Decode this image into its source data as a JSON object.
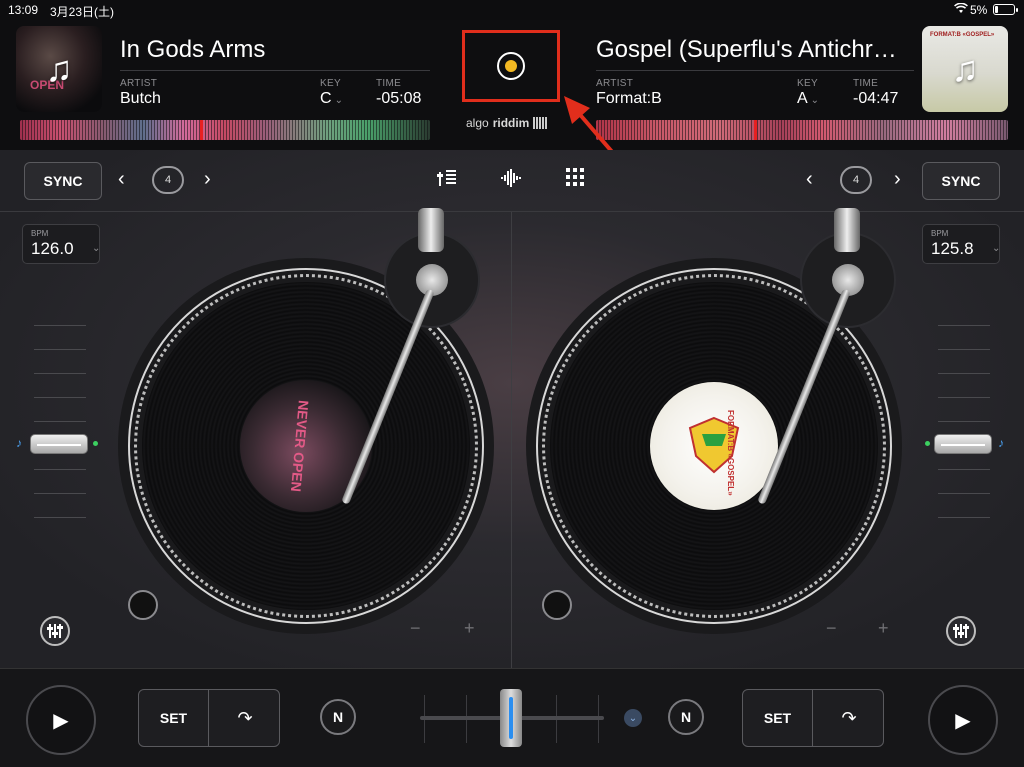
{
  "status_bar": {
    "time": "13:09",
    "date": "3月23日(土)",
    "battery": "5%"
  },
  "left_deck": {
    "title": "In Gods Arms",
    "artist_label": "ARTIST",
    "artist": "Butch",
    "key_label": "KEY",
    "key": "C",
    "time_label": "TIME",
    "time": "-05:08",
    "bpm_label": "BPM",
    "bpm": "126.0",
    "loop_count": "4",
    "sync": "SYNC",
    "set": "SET",
    "cover_text": "OPEN",
    "label_text": "NEVER OPEN"
  },
  "right_deck": {
    "title": "Gospel (Superflu's Antichr…",
    "artist_label": "ARTIST",
    "artist": "Format:B",
    "key_label": "KEY",
    "key": "A",
    "time_label": "TIME",
    "time": "-04:47",
    "bpm_label": "BPM",
    "bpm": "125.8",
    "loop_count": "4",
    "sync": "SYNC",
    "set": "SET",
    "cover_text": "FORMAT:B «GOSPEL»",
    "label_text": "FORMAT:B «GOSPEL»"
  },
  "branding": {
    "part1": "algo",
    "part2": "riddim"
  },
  "controls": {
    "minus": "−",
    "plus": "+",
    "n_label": "N"
  },
  "colors": {
    "record_dot": "#f2b822",
    "annotation": "#e12e1c",
    "playhead": "#e82020",
    "crossfader_accent": "#2a8ef0"
  },
  "icons": [
    "record-icon",
    "wifi-icon",
    "battery-icon",
    "loop-icon",
    "chevron-left-icon",
    "chevron-right-icon",
    "mixer-icon",
    "waveform-icon",
    "grid-icon",
    "play-icon",
    "cue-jump-icon",
    "eq-icon",
    "music-note-icon"
  ]
}
